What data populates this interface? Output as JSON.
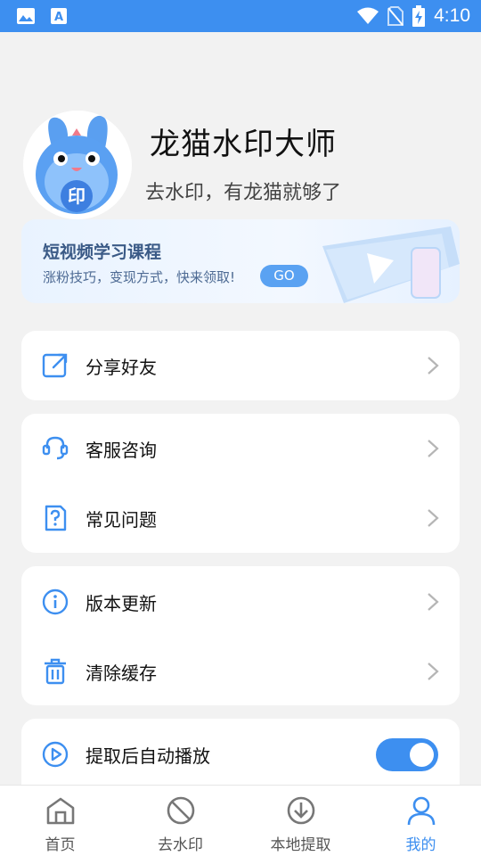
{
  "status_bar": {
    "time": "4:10",
    "notif_icons": [
      "image-icon",
      "text-a-icon"
    ],
    "system_icons": [
      "wifi-icon",
      "no-sim-icon",
      "battery-charging-icon"
    ]
  },
  "profile": {
    "app_name": "龙猫水印大师",
    "slogan": "去水印，有龙猫就够了"
  },
  "banner": {
    "title": "短视频学习课程",
    "subtitle": "涨粉技巧，变现方式，快来领取!",
    "go_label": "GO"
  },
  "menu": {
    "share": {
      "label": "分享好友",
      "icon": "share-icon"
    },
    "support": {
      "label": "客服咨询",
      "icon": "headset-icon"
    },
    "faq": {
      "label": "常见问题",
      "icon": "question-doc-icon"
    },
    "update": {
      "label": "版本更新",
      "icon": "info-icon"
    },
    "clear_cache": {
      "label": "清除缓存",
      "icon": "trash-icon"
    },
    "autoplay": {
      "label": "提取后自动播放",
      "icon": "play-circle-icon",
      "enabled": true
    }
  },
  "tabs": [
    {
      "label": "首页",
      "icon": "home-icon",
      "active": false
    },
    {
      "label": "去水印",
      "icon": "no-sign-icon",
      "active": false
    },
    {
      "label": "本地提取",
      "icon": "download-circle-icon",
      "active": false
    },
    {
      "label": "我的",
      "icon": "user-icon",
      "active": true
    }
  ],
  "colors": {
    "accent": "#3d8ff0",
    "background": "#f2f2f2",
    "card": "#ffffff"
  }
}
